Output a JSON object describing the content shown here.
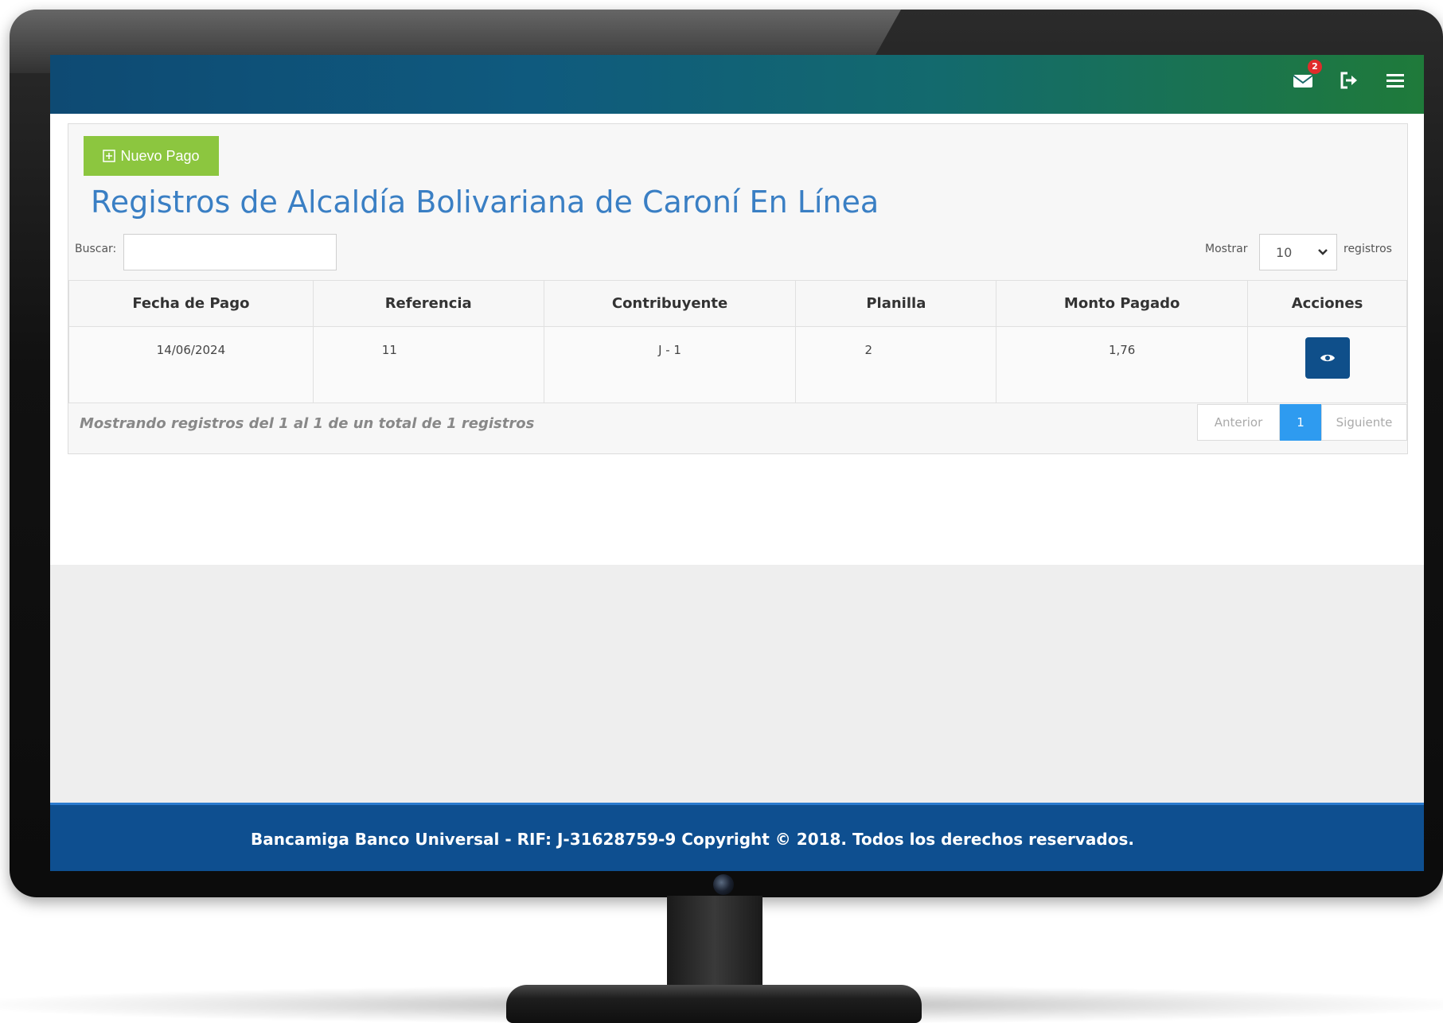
{
  "header": {
    "notification_count": "2",
    "icons": [
      "mail-icon",
      "logout-icon",
      "menu-icon"
    ]
  },
  "toolbar": {
    "new_payment_label": "Nuevo Pago"
  },
  "page": {
    "title": "Registros de Alcaldía Bolivariana de Caroní En Línea"
  },
  "search": {
    "label": "Buscar:",
    "value": ""
  },
  "length_menu": {
    "prefix": "Mostrar",
    "selected": "10",
    "suffix": "registros"
  },
  "table": {
    "columns": [
      "Fecha de Pago",
      "Referencia",
      "Contribuyente",
      "Planilla",
      "Monto Pagado",
      "Acciones"
    ],
    "rows": [
      {
        "fecha": "14/06/2024",
        "referencia": "11",
        "contribuyente": "J - 1",
        "planilla": "2",
        "monto": "1,76"
      }
    ]
  },
  "table_info": "Mostrando registros del 1 al 1 de un total de 1 registros",
  "pagination": {
    "previous": "Anterior",
    "current": "1",
    "next": "Siguiente"
  },
  "footer": {
    "text": "Bancamiga Banco Universal - RIF: J-31628759-9 Copyright © 2018. Todos los derechos reservados."
  },
  "colors": {
    "accent_green": "#8cc63f",
    "title_blue": "#3a7fc4",
    "footer_blue": "#0e4f90",
    "action_button": "#0f4f8a",
    "pager_active": "#2e9bf0",
    "badge_red": "#e02b2b"
  }
}
